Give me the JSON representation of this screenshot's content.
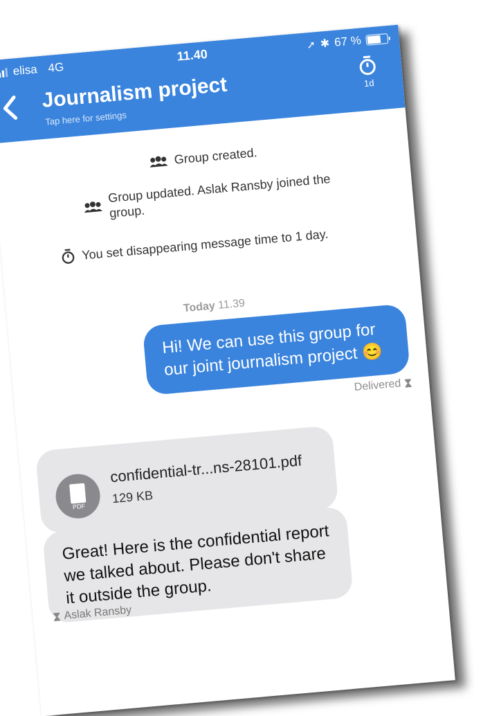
{
  "status_bar": {
    "carrier": "elisa",
    "network": "4G",
    "time": "11.40",
    "battery": "67 %",
    "battery_level": 0.67
  },
  "header": {
    "title": "Journalism project",
    "subtitle": "Tap here for settings",
    "timer_label": "1d",
    "color": "#3a84dd"
  },
  "system_messages": [
    "Group created.",
    "Group updated. Aslak Ransby joined the group.",
    "You set disappearing message time to 1 day."
  ],
  "date_separator": {
    "day": "Today",
    "time": "11.39"
  },
  "messages": {
    "outgoing": {
      "text": "Hi! We can use this group for our joint journalism project 😊",
      "status": "Delivered"
    },
    "attachment": {
      "icon_label": "PDF",
      "filename": "confidential-tr...ns-28101.pdf",
      "size": "129 KB"
    },
    "incoming": {
      "text": "Great! Here is the confidential report we talked about. Please don't share it outside the group.",
      "sender": "Aslak Ransby"
    }
  },
  "icons": {
    "back": "chevron-left-icon",
    "timer": "timer-icon",
    "group": "group-icon",
    "hourglass": "hourglass-icon",
    "pdf": "pdf-file-icon"
  }
}
